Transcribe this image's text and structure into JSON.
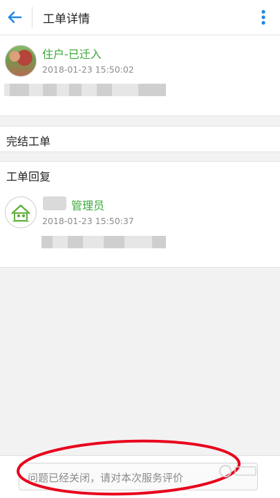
{
  "header": {
    "title": "工单详情",
    "back_icon": "arrow-left-icon",
    "menu_icon": "more-vertical-icon",
    "accent": "#1e88e5"
  },
  "post": {
    "author": "住户-已迁入",
    "time": "2018-01-23 15:50:02",
    "name_color": "#3aa83a"
  },
  "action": {
    "label": "完结工单"
  },
  "reply_section": {
    "title": "工单回复"
  },
  "reply": {
    "role": "管理员",
    "time": "2018-01-23 15:50:37"
  },
  "bottom": {
    "input_text": "问题已经关闭，请对本次服务评价",
    "annotation_color": "#e8001c"
  }
}
